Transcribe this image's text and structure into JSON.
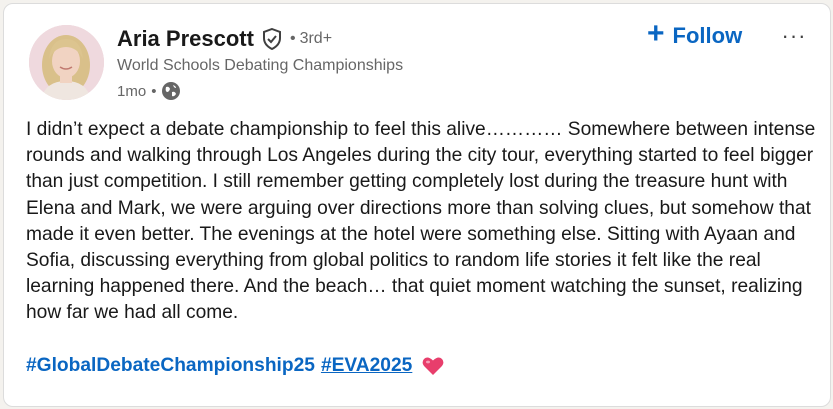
{
  "author": {
    "name": "Aria Prescott",
    "degree": "3rd+",
    "headline": "World Schools Debating Championships",
    "time_ago": "1mo",
    "verified_icon": "verified-shield-icon",
    "visibility_icon": "globe-icon"
  },
  "actions": {
    "follow_label": "Follow",
    "more_label": "···"
  },
  "post": {
    "body": "I didn’t expect a debate championship to feel this alive………… Somewhere between intense rounds and walking through Los Angeles during the city tour, everything started to feel bigger than just competition. I still remember getting completely lost during the treasure hunt with Elena and Mark, we were arguing over directions more than solving clues, but somehow that made it even better. The evenings at the hotel were something else. Sitting with Ayaan and Sofia, discussing everything from global politics to random life stories it felt like the real learning happened there. And the beach… that quiet moment watching the sunset, realizing how far we had all come.",
    "hashtags": [
      "#GlobalDebateChampionship25",
      "#EVA2025"
    ],
    "emoji": "heart-icon"
  },
  "colors": {
    "link_blue": "#0a66c2",
    "text_primary": "#191919",
    "text_secondary": "#666666",
    "heart": "#e83e6c"
  }
}
